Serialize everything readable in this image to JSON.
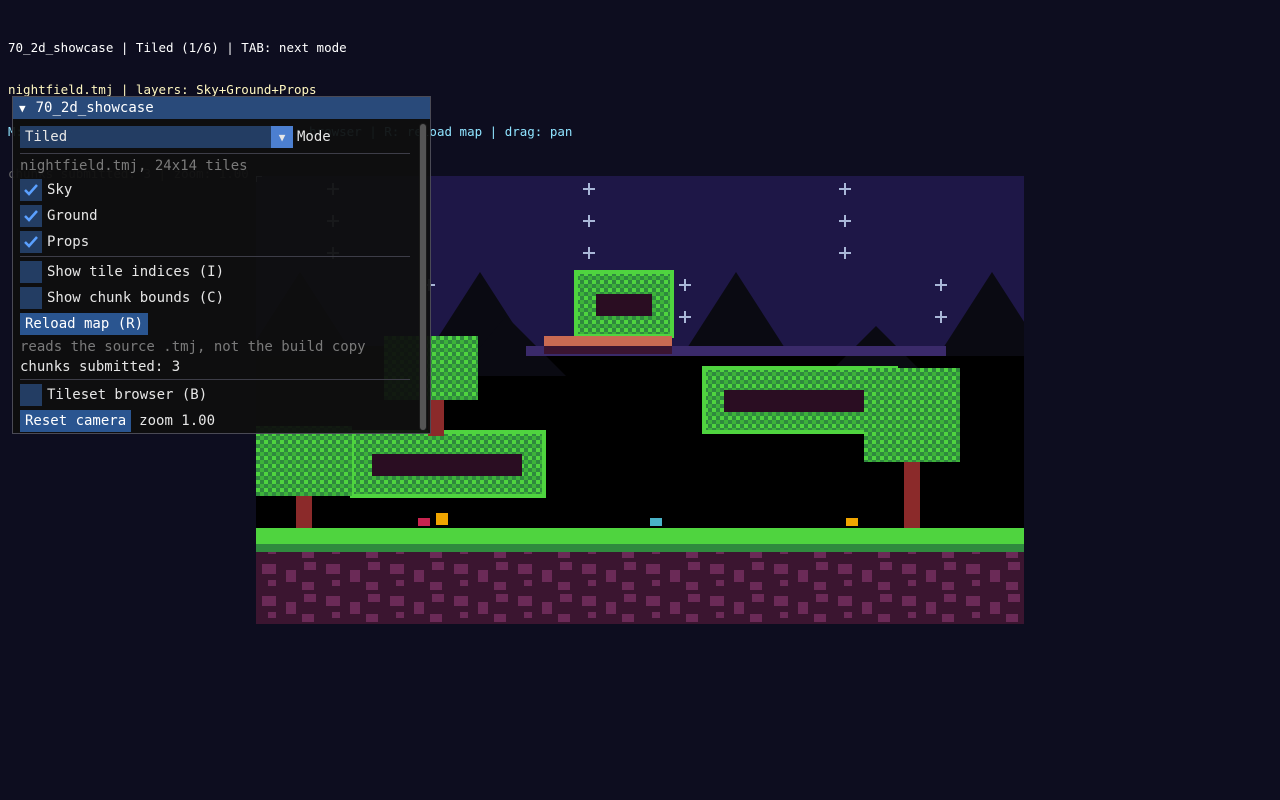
{
  "hud": {
    "line1": "70_2d_showcase | Tiled (1/6) | TAB: next mode",
    "line2": "nightfield.tmj | layers: Sky+Ground+Props",
    "line3": "M: layers | I: indices | C: chunks | B: browser | R: reload map | drag: pan",
    "line4": "chunks submitted: 3 | zoom: 1.00"
  },
  "panel": {
    "title": "70_2d_showcase",
    "mode_value": "Tiled",
    "mode_label": "Mode",
    "map_info": "nightfield.tmj, 24x14 tiles",
    "layers": [
      {
        "label": "Sky",
        "checked": true
      },
      {
        "label": "Ground",
        "checked": true
      },
      {
        "label": "Props",
        "checked": true
      }
    ],
    "show_indices": {
      "label": "Show tile indices (I)",
      "checked": false
    },
    "show_chunks": {
      "label": "Show chunk bounds (C)",
      "checked": false
    },
    "reload_button": "Reload map (R)",
    "reload_note": "reads the source .tmj, not the build copy",
    "chunks_text": "chunks submitted: 3",
    "tileset_browser": {
      "label": "Tileset browser (B)",
      "checked": false
    },
    "reset_button": "Reset camera",
    "zoom_text": "zoom 1.00"
  },
  "colors": {
    "sky": "#1e1747",
    "grass": "#4fd43f",
    "dirt": "#3b1530",
    "accent": "#294a7a"
  }
}
